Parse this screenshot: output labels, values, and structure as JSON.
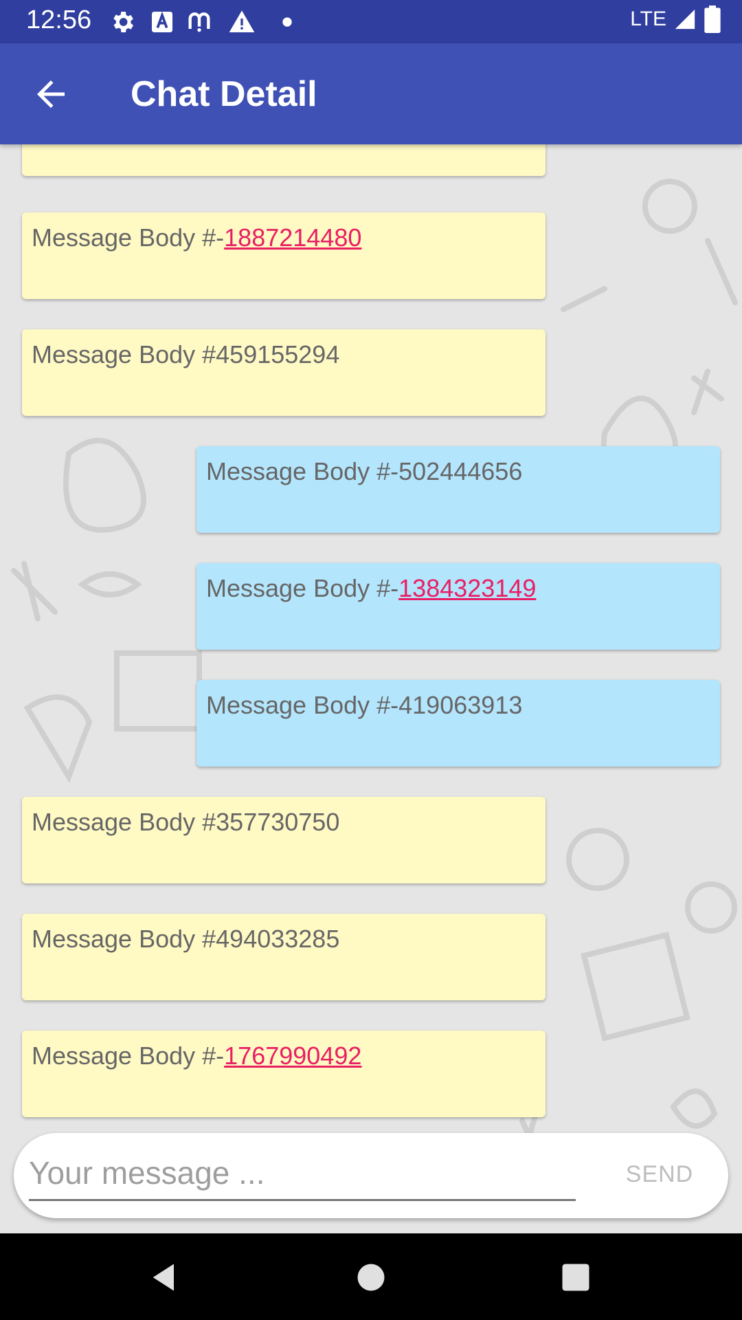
{
  "status_bar": {
    "time": "12:56",
    "network": "LTE"
  },
  "app_bar": {
    "title": "Chat Detail"
  },
  "messages": [
    {
      "prefix": "Message Body #-",
      "link": "1887214480",
      "direction": "incoming"
    },
    {
      "prefix": "Message Body #459155294",
      "link": "",
      "direction": "incoming"
    },
    {
      "prefix": "Message Body #-502444656",
      "link": "",
      "direction": "outgoing"
    },
    {
      "prefix": "Message Body #-",
      "link": "1384323149",
      "direction": "outgoing"
    },
    {
      "prefix": "Message Body #-419063913",
      "link": "",
      "direction": "outgoing"
    },
    {
      "prefix": "Message Body #357730750",
      "link": "",
      "direction": "incoming"
    },
    {
      "prefix": "Message Body #494033285",
      "link": "",
      "direction": "incoming"
    },
    {
      "prefix": "Message Body #-",
      "link": "1767990492",
      "direction": "incoming"
    }
  ],
  "composer": {
    "placeholder": "Your message ...",
    "value": "",
    "send_label": "SEND"
  },
  "colors": {
    "status_bar": "#303f9f",
    "app_bar": "#3f51b5",
    "incoming_bubble": "#fff9c4",
    "outgoing_bubble": "#b3e5fc",
    "link": "#e91e63"
  },
  "icons": {
    "status_left": [
      "gear-icon",
      "a-icon",
      "m-icon",
      "warning-icon",
      "dot-icon"
    ],
    "status_right": [
      "signal-icon",
      "battery-icon"
    ],
    "app_bar": [
      "back-arrow-icon"
    ],
    "nav": [
      "back-triangle-icon",
      "home-circle-icon",
      "recents-square-icon"
    ]
  }
}
